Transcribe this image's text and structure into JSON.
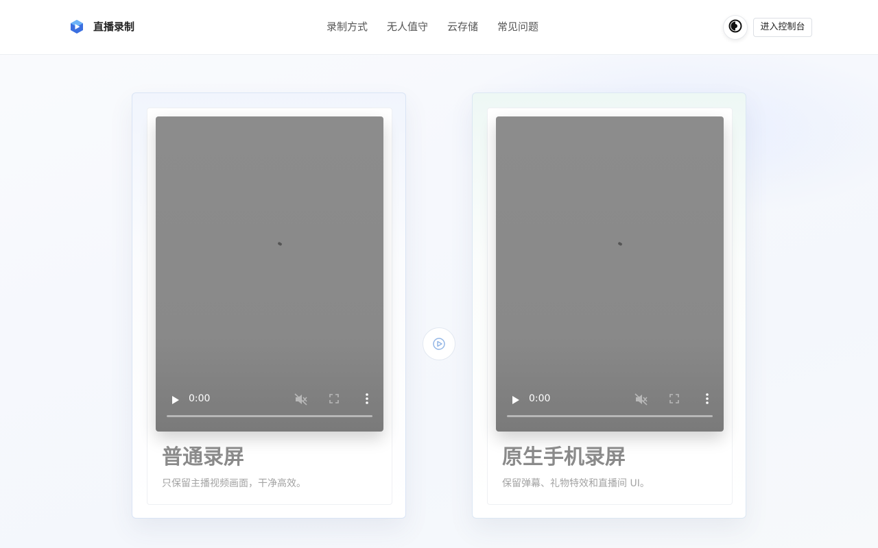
{
  "header": {
    "brand": "直播录制",
    "nav": [
      "录制方式",
      "无人值守",
      "云存储",
      "常见问题"
    ],
    "console_label": "进入控制台",
    "theme_icon": "contrast-icon"
  },
  "cards": [
    {
      "title": "普通录屏",
      "description": "只保留主播视频画面，干净高效。",
      "player": {
        "time": "0:00",
        "icons": [
          "play-icon",
          "muted-icon",
          "fullscreen-icon",
          "more-vert-icon"
        ]
      }
    },
    {
      "title": "原生手机录屏",
      "description": "保留弹幕、礼物特效和直播间 UI。",
      "player": {
        "time": "0:00",
        "icons": [
          "play-icon",
          "muted-icon",
          "fullscreen-icon",
          "more-vert-icon"
        ]
      }
    }
  ],
  "center_icon": "play-circle-icon",
  "colors": {
    "accent": "#3b6fe0",
    "logo_light": "#5fa8f5",
    "card_title": "#8a8a8a"
  }
}
